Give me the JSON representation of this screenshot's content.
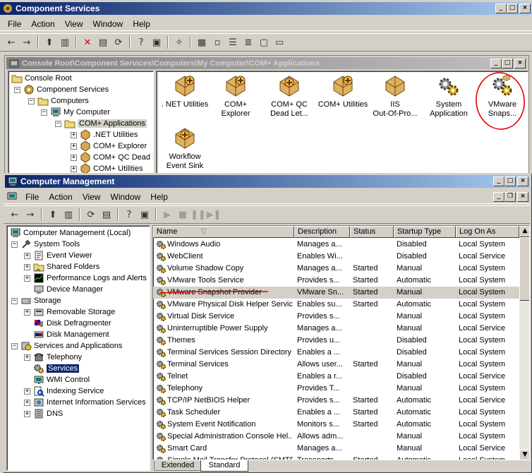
{
  "component_services": {
    "title": "Component Services",
    "menu": [
      "File",
      "Action",
      "View",
      "Window",
      "Help"
    ],
    "console_path": "Console Root\\Component Services\\Computers\\My Computer\\COM+ Applications",
    "tree": [
      {
        "label": "Console Root"
      },
      {
        "label": "Component Services"
      },
      {
        "label": "Computers"
      },
      {
        "label": "My Computer"
      },
      {
        "label": "COM+ Applications"
      },
      {
        "label": ".NET Utilities"
      },
      {
        "label": "COM+ Explorer"
      },
      {
        "label": "COM+ QC Dead L"
      },
      {
        "label": "COM+ Utilities"
      }
    ],
    "apps": [
      {
        "line1": ". NET Utilities",
        "line2": ""
      },
      {
        "line1": "COM+",
        "line2": "Explorer"
      },
      {
        "line1": "COM+ QC",
        "line2": "Dead Let..."
      },
      {
        "line1": "COM+ Utilities",
        "line2": ""
      },
      {
        "line1": "IIS",
        "line2": "Out-Of-Pro..."
      },
      {
        "line1": "System",
        "line2": "Application"
      },
      {
        "line1": "VMware",
        "line2": "Snaps..."
      },
      {
        "line1": "Workflow",
        "line2": "Event Sink"
      }
    ]
  },
  "computer_management": {
    "title": "Computer Management",
    "menu": [
      "File",
      "Action",
      "View",
      "Window",
      "Help"
    ],
    "tree": [
      {
        "label": "Computer Management (Local)"
      },
      {
        "label": "System Tools"
      },
      {
        "label": "Event Viewer"
      },
      {
        "label": "Shared Folders"
      },
      {
        "label": "Performance Logs and Alerts"
      },
      {
        "label": "Device Manager"
      },
      {
        "label": "Storage"
      },
      {
        "label": "Removable Storage"
      },
      {
        "label": "Disk Defragmenter"
      },
      {
        "label": "Disk Management"
      },
      {
        "label": "Services and Applications"
      },
      {
        "label": "Telephony"
      },
      {
        "label": "Services"
      },
      {
        "label": "WMI Control"
      },
      {
        "label": "Indexing Service"
      },
      {
        "label": "Internet Information Services"
      },
      {
        "label": "DNS"
      }
    ],
    "columns": {
      "name": "Name",
      "description": "Description",
      "status": "Status",
      "startup": "Startup Type",
      "logon": "Log On As"
    },
    "services": [
      {
        "name": "Windows Audio",
        "desc": "Manages a...",
        "status": "",
        "startup": "Disabled",
        "logon": "Local System"
      },
      {
        "name": "WebClient",
        "desc": "Enables Wi...",
        "status": "",
        "startup": "Disabled",
        "logon": "Local Service"
      },
      {
        "name": "Volume Shadow Copy",
        "desc": "Manages a...",
        "status": "Started",
        "startup": "Manual",
        "logon": "Local System"
      },
      {
        "name": "VMware Tools Service",
        "desc": "Provides s...",
        "status": "Started",
        "startup": "Automatic",
        "logon": "Local System"
      },
      {
        "name": "VMware Snapshot Provider",
        "desc": "VMware Sn...",
        "status": "Started",
        "startup": "Manual",
        "logon": "Local System"
      },
      {
        "name": "VMware Physical Disk Helper Service",
        "desc": "Enables su...",
        "status": "Started",
        "startup": "Automatic",
        "logon": "Local System"
      },
      {
        "name": "Virtual Disk Service",
        "desc": "Provides s...",
        "status": "",
        "startup": "Manual",
        "logon": "Local System"
      },
      {
        "name": "Uninterruptible Power Supply",
        "desc": "Manages a...",
        "status": "",
        "startup": "Manual",
        "logon": "Local Service"
      },
      {
        "name": "Themes",
        "desc": "Provides u...",
        "status": "",
        "startup": "Disabled",
        "logon": "Local System"
      },
      {
        "name": "Terminal Services Session Directory",
        "desc": "Enables a ...",
        "status": "",
        "startup": "Disabled",
        "logon": "Local System"
      },
      {
        "name": "Terminal Services",
        "desc": "Allows user...",
        "status": "Started",
        "startup": "Manual",
        "logon": "Local System"
      },
      {
        "name": "Telnet",
        "desc": "Enables a r...",
        "status": "",
        "startup": "Disabled",
        "logon": "Local Service"
      },
      {
        "name": "Telephony",
        "desc": "Provides T...",
        "status": "",
        "startup": "Manual",
        "logon": "Local System"
      },
      {
        "name": "TCP/IP NetBIOS Helper",
        "desc": "Provides s...",
        "status": "Started",
        "startup": "Automatic",
        "logon": "Local Service"
      },
      {
        "name": "Task Scheduler",
        "desc": "Enables a ...",
        "status": "Started",
        "startup": "Automatic",
        "logon": "Local System"
      },
      {
        "name": "System Event Notification",
        "desc": "Monitors s...",
        "status": "Started",
        "startup": "Automatic",
        "logon": "Local System"
      },
      {
        "name": "Special Administration Console Hel...",
        "desc": "Allows adm...",
        "status": "",
        "startup": "Manual",
        "logon": "Local System"
      },
      {
        "name": "Smart Card",
        "desc": "Manages a...",
        "status": "",
        "startup": "Manual",
        "logon": "Local Service"
      },
      {
        "name": "Simple Mail Transfer Protocol (SMTP)",
        "desc": "Transports ...",
        "status": "Started",
        "startup": "Automatic",
        "logon": "Local System"
      }
    ],
    "tabs": {
      "extended": "Extended",
      "standard": "Standard"
    }
  },
  "colors": {
    "title_active": "#0a246a",
    "annotation_red": "#e00000"
  }
}
